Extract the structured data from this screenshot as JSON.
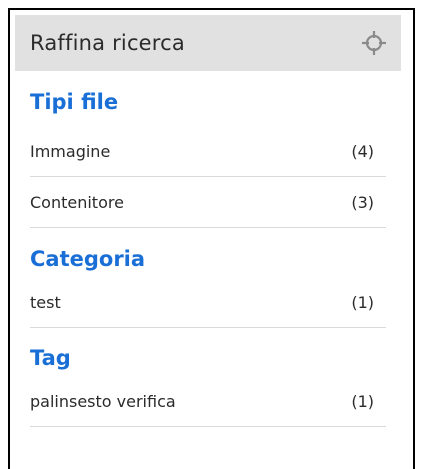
{
  "panel": {
    "title": "Raffina ricerca",
    "icon": "crosshair-icon",
    "accent_color": "#1a6fd6",
    "sections": [
      {
        "title": "Tipi file",
        "items": [
          {
            "label": "Immagine",
            "count": "(4)"
          },
          {
            "label": "Contenitore",
            "count": "(3)"
          }
        ]
      },
      {
        "title": "Categoria",
        "items": [
          {
            "label": "test",
            "count": "(1)"
          }
        ]
      },
      {
        "title": "Tag",
        "items": [
          {
            "label": "palinsesto verifica",
            "count": "(1)"
          }
        ]
      }
    ]
  }
}
